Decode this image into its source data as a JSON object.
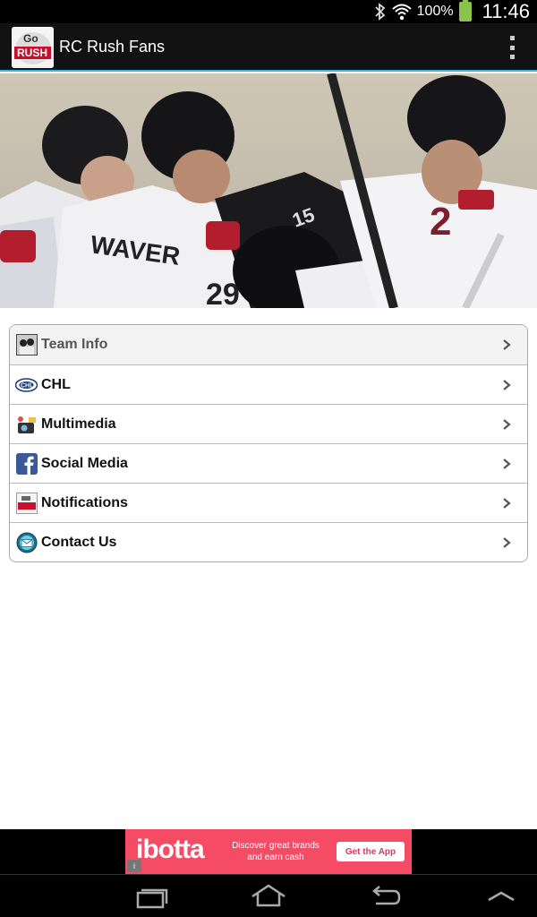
{
  "status_bar": {
    "battery_percent": "100%",
    "time": "11:46",
    "icons": [
      "bluetooth-icon",
      "wifi-icon",
      "battery-icon"
    ]
  },
  "action_bar": {
    "logo_text_top": "Go",
    "logo_text_bottom": "RUSH",
    "title": "RC Rush Fans",
    "overflow_icon": "overflow-menu-icon"
  },
  "hero": {
    "jersey_numbers": [
      "29",
      "15",
      "2"
    ],
    "jersey_name": "WAVER"
  },
  "menu": {
    "items": [
      {
        "label": "Team Info",
        "icon": "team-photo-icon"
      },
      {
        "label": "CHL",
        "icon": "chl-logo-icon"
      },
      {
        "label": "Multimedia",
        "icon": "multimedia-icon"
      },
      {
        "label": "Social Media",
        "icon": "facebook-icon"
      },
      {
        "label": "Notifications",
        "icon": "go-rush-icon"
      },
      {
        "label": "Contact Us",
        "icon": "contact-email-icon"
      }
    ]
  },
  "ad": {
    "brand": "ibotta",
    "tagline_line1": "Discover great brands",
    "tagline_line2": "and earn cash",
    "cta": "Get the App",
    "info": "i"
  },
  "colors": {
    "accent": "#33b5e5",
    "ad_background": "#f54b64",
    "battery": "#8bc34a"
  }
}
